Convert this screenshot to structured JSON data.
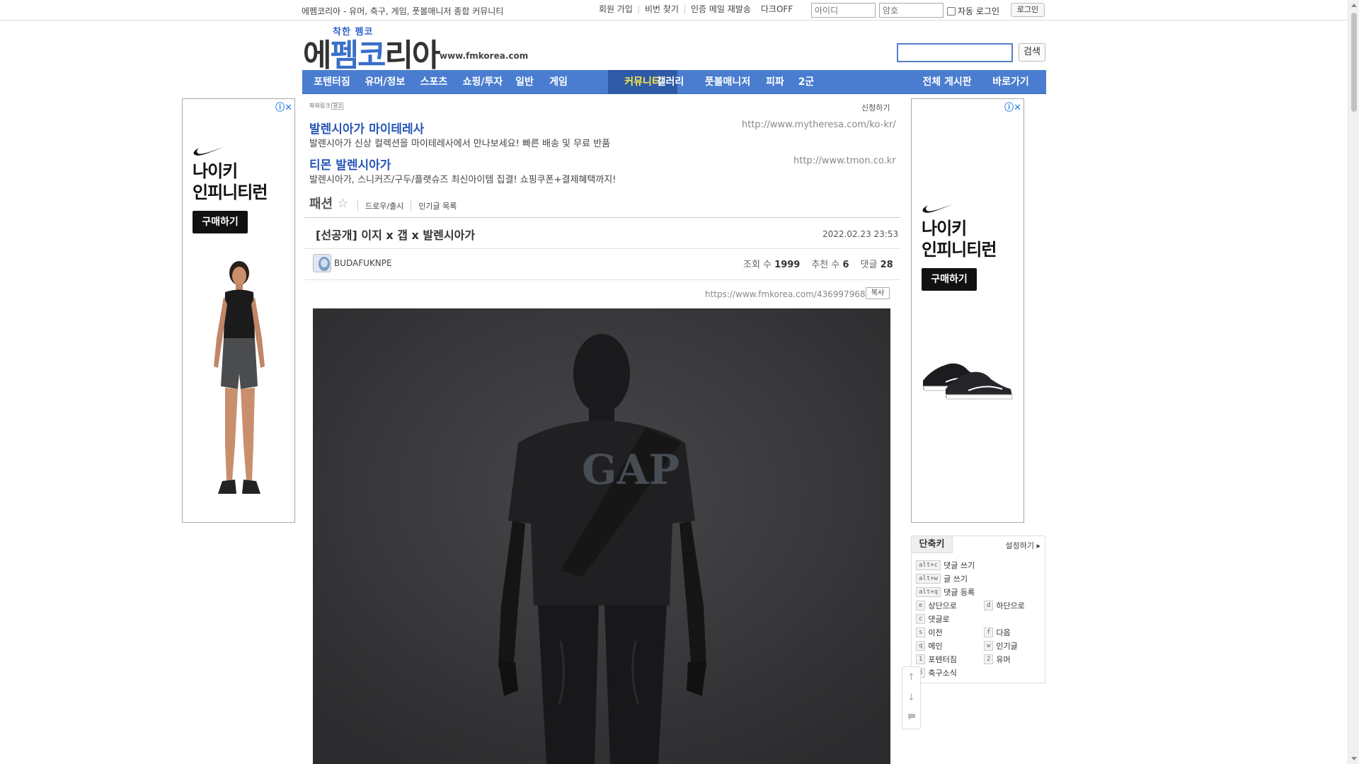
{
  "topbar": {
    "tagline": "에펨코리아 - 유머, 축구, 게임, 풋볼매니저 종합 커뮤니티",
    "links": [
      "회원 가입",
      "비번 찾기",
      "인증 메일 재발송"
    ],
    "dark_mode": "다크OFF",
    "id_placeholder": "아이디",
    "pw_placeholder": "암호",
    "auto_login": "자동 로그인",
    "login": "로그인"
  },
  "logo": {
    "slogan": "착한 펨코",
    "name_black1": "에",
    "name_blue": "펨코",
    "name_black2": "리아",
    "domain": "www.fmkorea.com"
  },
  "search": {
    "button": "검색"
  },
  "nav": {
    "items": [
      "포텐터짐",
      "유머/정보",
      "스포츠",
      "쇼핑/투자",
      "일반",
      "게임",
      "커뮤니티",
      "갤러리",
      "풋볼매니저",
      "피파",
      "2군"
    ],
    "right": [
      "전체 게시판",
      "바로가기"
    ],
    "active": "커뮤니티"
  },
  "ad_left": {
    "brand": "나이키\n인피니티런",
    "buy": "구매하기",
    "close": "ⓘ✕"
  },
  "ad_right": {
    "brand": "나이키\n인피니티런",
    "buy": "구매하기",
    "close": "ⓘ✕"
  },
  "powerlink": {
    "label": "파워링크",
    "tag": "광고",
    "apply": "신청하기",
    "ads": [
      {
        "title": "발렌시아가 마이테레사",
        "url": "http://www.mytheresa.com/ko-kr/",
        "desc": "발렌시아가 신상 컬렉션을 마이테레사에서 만나보세요! 빠른 배송 및 무료 반품"
      },
      {
        "title": "티몬 발렌시아가",
        "url": "http://www.tmon.co.kr",
        "desc": "발렌시아가, 스니커즈/구두/플랫슈즈 최신아이템 집결! 쇼핑쿠폰+결제혜택까지!"
      }
    ]
  },
  "board": {
    "name": "패션",
    "links": [
      "드로우/출시",
      "인기글 목록"
    ]
  },
  "post": {
    "title": "[선공개] 이지 x 갭 x 발렌시아가",
    "date": "2022.02.23 23:53",
    "author": "BUDAFUKNPE",
    "views_label": "조회 수",
    "views": "1999",
    "recommends_label": "추천 수",
    "recommends": "6",
    "comments_label": "댓글",
    "comments": "28",
    "url": "https://www.fmkorea.com/4369979682",
    "copy": "복사",
    "image_text": "GAP"
  },
  "shortcuts": {
    "tab": "단축키",
    "settings": "설정하기 ▸",
    "items": [
      {
        "key": "alt+c",
        "label": "댓글 쓰기"
      },
      {
        "key": "alt+w",
        "label": "글 쓰기"
      },
      {
        "key": "alt+q",
        "label": "댓글 등록"
      },
      {
        "key": "e",
        "label": "상단으로"
      },
      {
        "key": "d",
        "label": "하단으로"
      },
      {
        "key": "c",
        "label": "댓글로"
      },
      {
        "key": "s",
        "label": "이전"
      },
      {
        "key": "f",
        "label": "다음"
      },
      {
        "key": "q",
        "label": "메인"
      },
      {
        "key": "w",
        "label": "인기글"
      },
      {
        "key": "1",
        "label": "포텐터짐"
      },
      {
        "key": "2",
        "label": "유머"
      },
      {
        "key": "3",
        "label": "축구소식"
      }
    ]
  },
  "side_tools": {
    "up": "↑",
    "down": "↓",
    "comment": "💬"
  },
  "colors": {
    "nav_bg": "#4a7dd0",
    "nav_active": "#2e5aa6",
    "link_blue": "#2855b8"
  }
}
